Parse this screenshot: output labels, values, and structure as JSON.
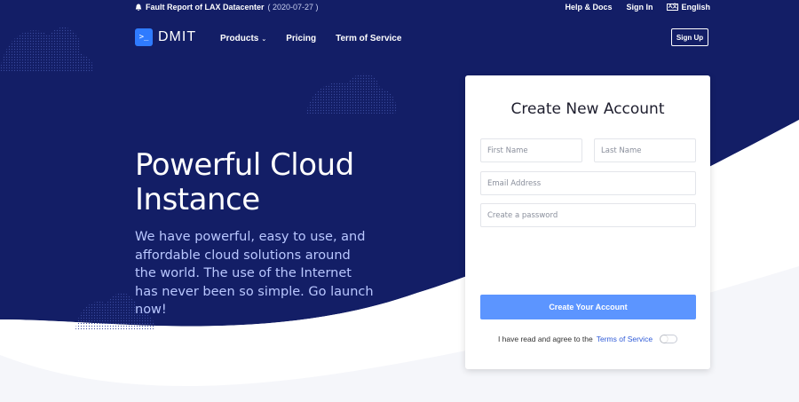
{
  "colors": {
    "hero": "#131e66",
    "accent": "#2f7bff",
    "button": "#5c95ff",
    "page": "#f5f6fa"
  },
  "topbar": {
    "notice_icon": "bell-icon",
    "notice_text": "Fault Report of LAX Datacenter",
    "notice_date": "( 2020-07-27 )",
    "help": "Help & Docs",
    "signin": "Sign In",
    "lang_icon": "language-icon",
    "lang_icon_text": "A文",
    "lang": "English"
  },
  "nav": {
    "logo_glyph": ">_",
    "logo_text": "DMIT",
    "products": "Products",
    "pricing": "Pricing",
    "terms": "Term of Service",
    "signup": "Sign Up"
  },
  "hero": {
    "headline": "Powerful Cloud Instance",
    "subtext": "We have powerful, easy to use, and affordable cloud solutions around the world. The use of the Internet has never been so simple. Go launch now!"
  },
  "form": {
    "title": "Create New Account",
    "first_name_placeholder": "First Name",
    "last_name_placeholder": "Last Name",
    "email_placeholder": "Email Address",
    "password_placeholder": "Create a password",
    "submit": "Create Your Account",
    "agree_text": "I have read and agree to the",
    "agree_link": "Terms of Service",
    "agree_checked": false
  }
}
